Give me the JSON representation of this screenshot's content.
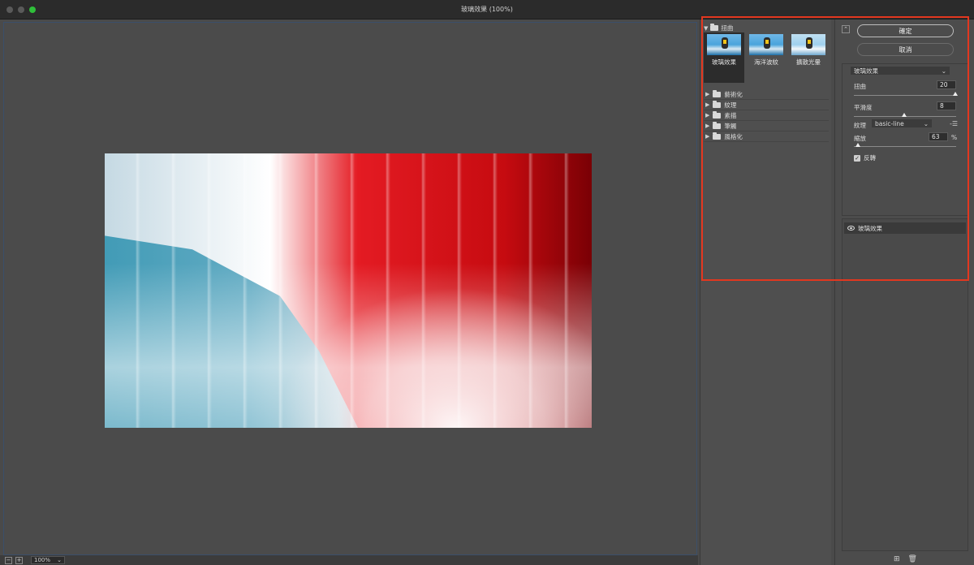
{
  "window": {
    "title": "玻璃效果 (100%)"
  },
  "status_bar": {
    "zoom_value": "100%"
  },
  "gallery": {
    "category_label": "扭曲",
    "thumbnails": [
      {
        "label": "玻璃效果",
        "selected": true
      },
      {
        "label": "海洋波紋",
        "selected": false
      },
      {
        "label": "擴散光暈",
        "selected": false
      }
    ],
    "folders": [
      {
        "label": "藝術化"
      },
      {
        "label": "紋理"
      },
      {
        "label": "素描"
      },
      {
        "label": "筆觸"
      },
      {
        "label": "風格化"
      }
    ]
  },
  "settings": {
    "ok_label": "確定",
    "cancel_label": "取消",
    "filter_select_value": "玻璃效果",
    "distortion": {
      "label": "扭曲",
      "value": "20"
    },
    "smoothness": {
      "label": "平滑度",
      "value": "8"
    },
    "texture": {
      "label": "紋理",
      "value": "basic-line"
    },
    "scaling": {
      "label": "縮放",
      "value": "63",
      "unit": "%"
    },
    "invert": {
      "label": "反轉",
      "checked": true
    }
  },
  "layers": {
    "items": [
      {
        "label": "玻璃效果"
      }
    ]
  },
  "colors": {
    "highlight": "#e2371f",
    "zoom_green": "#2fbf3a"
  }
}
